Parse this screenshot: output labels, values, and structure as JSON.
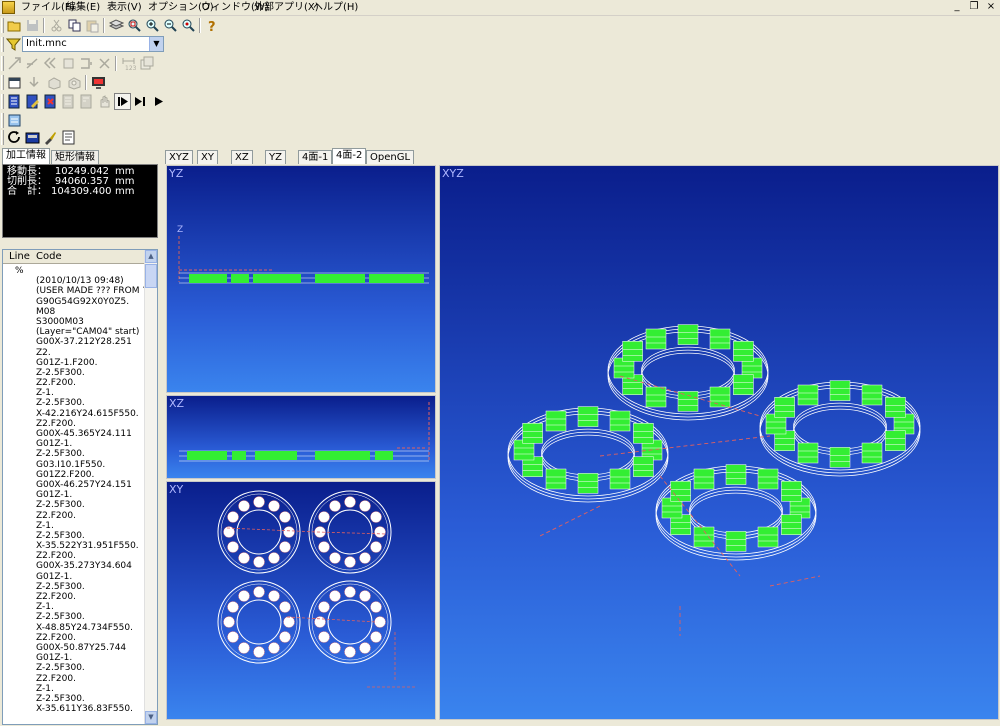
{
  "menubar": {
    "items": [
      "ファイル(F)",
      "編集(E)",
      "表示(V)",
      "オプション(O)",
      "ウィンドウ(W)",
      "外部アプリ(X)",
      "ヘルプ(H)"
    ],
    "window_controls": [
      "_",
      "❐",
      "×"
    ]
  },
  "file_combo": {
    "value": "Init.mnc"
  },
  "left_tabs": [
    "加工情報",
    "矩形情報"
  ],
  "info": [
    {
      "label": "移動長：",
      "value": "10249.042",
      "unit": "mm"
    },
    {
      "label": "切削長：",
      "value": "94060.357",
      "unit": "mm"
    },
    {
      "label": "合　計：",
      "value": "104309.400",
      "unit": "mm"
    }
  ],
  "code_list": {
    "headers": [
      "Line",
      "Code"
    ],
    "first_line_number": "%",
    "rows": [
      "(2010/10/13 09:48)",
      "(USER MADE ??? FROM ???",
      "G90G54G92X0Y0Z5.",
      "M08",
      "S3000M03",
      "(Layer=\"CAM04\" start)",
      "G00X-37.212Y28.251",
      "Z2.",
      "G01Z-1.F200.",
      "Z-2.5F300.",
      "Z2.F200.",
      "Z-1.",
      "Z-2.5F300.",
      "X-42.216Y24.615F550.",
      "Z2.F200.",
      "G00X-45.365Y24.111",
      "G01Z-1.",
      "Z-2.5F300.",
      "G03.I10.1F550.",
      "G01Z2.F200.",
      "G00X-46.257Y24.151",
      "G01Z-1.",
      "Z-2.5F300.",
      "Z2.F200.",
      "Z-1.",
      "Z-2.5F300.",
      "X-35.522Y31.951F550.",
      "Z2.F200.",
      "G00X-35.273Y34.604",
      "G01Z-1.",
      "Z-2.5F300.",
      "Z2.F200.",
      "Z-1.",
      "Z-2.5F300.",
      "X-48.85Y24.734F550.",
      "Z2.F200.",
      "G00X-50.87Y25.744",
      "G01Z-1.",
      "Z-2.5F300.",
      "Z2.F200.",
      "Z-1.",
      "Z-2.5F300.",
      "X-35.611Y36.83F550."
    ]
  },
  "view_tabs": [
    "XYZ",
    "XY",
    "XZ",
    "YZ",
    "4面-1",
    "4面-2",
    "OpenGL"
  ],
  "active_view_tab": "4面-2",
  "views": {
    "yz": {
      "label": "YZ",
      "axis": "Z"
    },
    "xz": {
      "label": "XZ"
    },
    "xy": {
      "label": "XY"
    },
    "xyz": {
      "label": "XYZ"
    }
  },
  "colors": {
    "viewport_top": "#0a1e8c",
    "viewport_bottom": "#3a84ee",
    "toolpath": "#33ee33",
    "outline": "#ffffff",
    "rapid": "#e06060"
  }
}
